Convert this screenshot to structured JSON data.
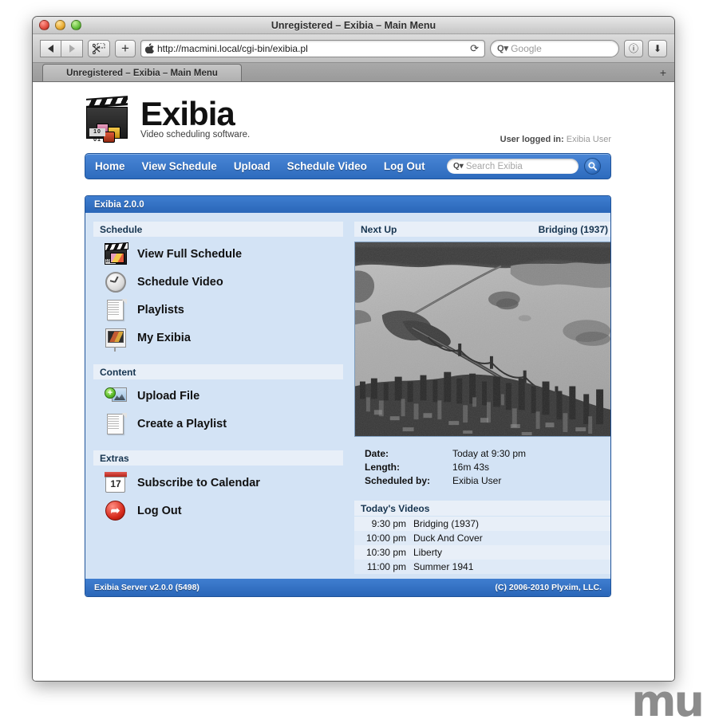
{
  "browser": {
    "window_title": "Unregistered – Exibia – Main Menu",
    "tab_title": "Unregistered – Exibia – Main Menu",
    "url": "http://macmini.local/cgi-bin/exibia.pl",
    "reload_glyph": "⟳",
    "search_placeholder": "Google",
    "add_tab_label": "+",
    "new_tab_label": "+",
    "info_label": "ⓘ",
    "downloads_label": "⬇",
    "search_q_glyph": "Q▾"
  },
  "site": {
    "logo_title": "Exibia",
    "logo_tagline": "Video scheduling software.",
    "clapper_number": "10 01",
    "user_logged_in_label": "User logged in:",
    "user_name": "Exibia User"
  },
  "nav": {
    "items": [
      {
        "label": "Home"
      },
      {
        "label": "View Schedule"
      },
      {
        "label": "Upload"
      },
      {
        "label": "Schedule Video"
      },
      {
        "label": "Log Out"
      }
    ],
    "search_placeholder": "Search Exibia",
    "search_q_glyph": "Q▾",
    "search_button_glyph": "🔍"
  },
  "panel": {
    "header_title": "Exibia 2.0.0",
    "footer_left": "Exibia Server v2.0.0 (5498)",
    "footer_right": "(C) 2006-2010 Plyxim, LLC."
  },
  "sidebar": {
    "sections": [
      {
        "title": "Schedule",
        "items": [
          {
            "label": "View Full Schedule",
            "icon": "clapperboard-icon",
            "icon_number": "10 01"
          },
          {
            "label": "Schedule Video",
            "icon": "clock-icon"
          },
          {
            "label": "Playlists",
            "icon": "document-icon"
          },
          {
            "label": "My Exibia",
            "icon": "projector-screen-icon"
          }
        ]
      },
      {
        "title": "Content",
        "items": [
          {
            "label": "Upload File",
            "icon": "add-image-icon",
            "plus": "+"
          },
          {
            "label": "Create a Playlist",
            "icon": "document-icon"
          }
        ]
      },
      {
        "title": "Extras",
        "items": [
          {
            "label": "Subscribe to Calendar",
            "icon": "calendar-icon",
            "day": "17"
          },
          {
            "label": "Log Out",
            "icon": "logout-arrow-icon",
            "glyph": "➦"
          }
        ]
      }
    ]
  },
  "next_up": {
    "header": "Next Up",
    "title": "Bridging (1937)",
    "thumbnail_description": "Black and white aerial photograph of a suspension bridge crossing a bay toward a dense city skyline",
    "details": [
      {
        "label": "Date:",
        "value": "Today at 9:30 pm"
      },
      {
        "label": "Length:",
        "value": "16m 43s"
      },
      {
        "label": "Scheduled by:",
        "value": "Exibia User"
      }
    ]
  },
  "todays_videos": {
    "header": "Today's Videos",
    "rows": [
      {
        "time": "9:30 pm",
        "title": "Bridging (1937)"
      },
      {
        "time": "10:00 pm",
        "title": "Duck And Cover"
      },
      {
        "time": "10:30 pm",
        "title": "Liberty"
      },
      {
        "time": "11:00 pm",
        "title": "Summer 1941"
      }
    ]
  },
  "watermark": {
    "text": "mu"
  },
  "colors": {
    "accent_blue": "#2d6bbd",
    "panel_bg": "#d3e3f5",
    "section_header_bg": "#e8eff8",
    "row_alt_bg": "#dfeaf7"
  }
}
